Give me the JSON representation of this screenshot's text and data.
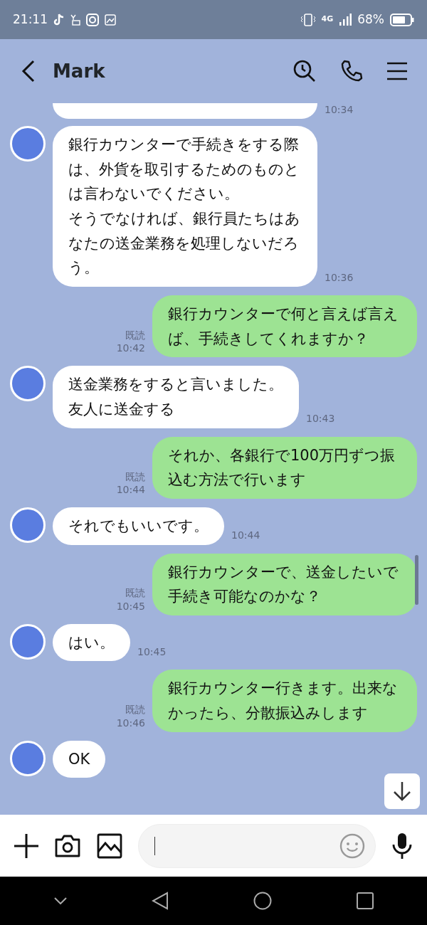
{
  "status_bar": {
    "time": "21:11",
    "network": "4G",
    "battery": "68%"
  },
  "header": {
    "title": "Mark"
  },
  "messages": [
    {
      "kind": "received",
      "time": "10:34"
    },
    {
      "kind": "received",
      "lines": [
        "銀行カウンターで手続きをする際は、外貨を取引するためのものとは言わないでください。",
        "そうでなければ、銀行員たちはあなたの送金業務を処理しないだろう。"
      ],
      "time": "10:36",
      "avatar": true
    },
    {
      "kind": "sent",
      "lines": [
        "銀行カウンターで何と言えば言えば、手続きしてくれますか？"
      ],
      "time": "10:42",
      "read": "既読"
    },
    {
      "kind": "received",
      "lines": [
        "送金業務をすると言いました。",
        "友人に送金する"
      ],
      "time": "10:43",
      "avatar": true
    },
    {
      "kind": "sent",
      "lines": [
        "それか、各銀行で100万円ずつ振込む方法で行います"
      ],
      "time": "10:44",
      "read": "既読"
    },
    {
      "kind": "received",
      "lines": [
        "それでもいいです。"
      ],
      "time": "10:44",
      "avatar": true
    },
    {
      "kind": "sent",
      "lines": [
        "銀行カウンターで、送金したいで手続き可能なのかな？"
      ],
      "time": "10:45",
      "read": "既読"
    },
    {
      "kind": "received",
      "lines": [
        "はい。"
      ],
      "time": "10:45",
      "avatar": true
    },
    {
      "kind": "sent",
      "lines": [
        "銀行カウンター行きます。出来なかったら、分散振込みします"
      ],
      "time": "10:46",
      "read": "既読"
    },
    {
      "kind": "received",
      "lines": [
        "OK"
      ],
      "avatar": true
    }
  ]
}
